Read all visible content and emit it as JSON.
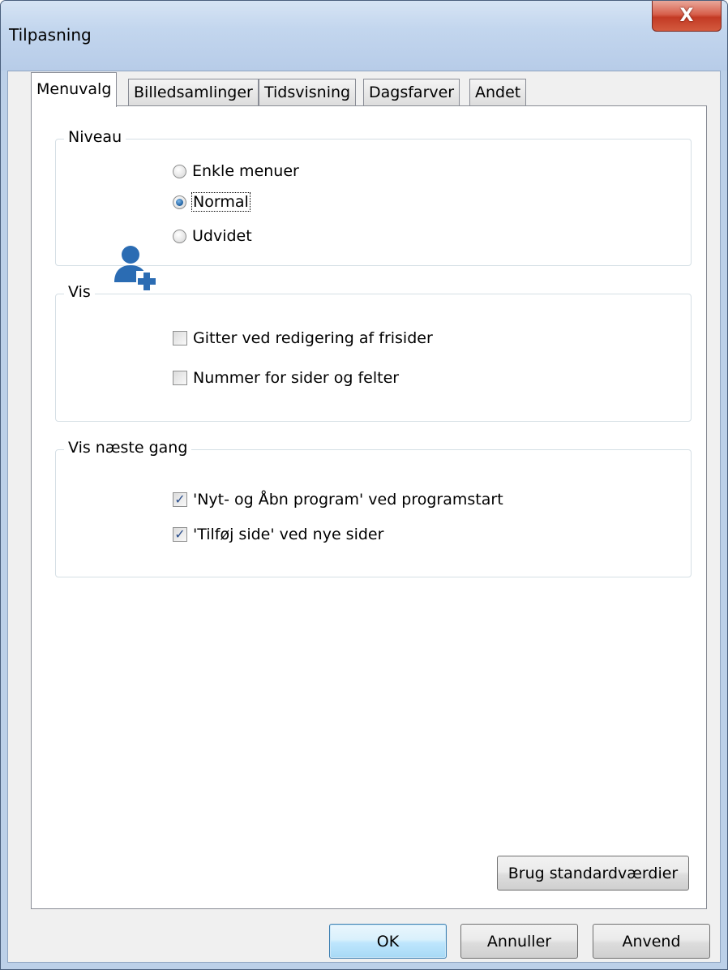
{
  "window": {
    "title": "Tilpasning",
    "close_label": "X"
  },
  "tabs": [
    {
      "label": "Menuvalg",
      "active": true
    },
    {
      "label": "Billedsamlinger",
      "active": false
    },
    {
      "label": "Tidsvisning",
      "active": false
    },
    {
      "label": "Dagsfarver",
      "active": false
    },
    {
      "label": "Andet",
      "active": false
    }
  ],
  "niveau": {
    "label": "Niveau",
    "icon": "user-add-icon",
    "options": [
      {
        "label": "Enkle menuer",
        "checked": false
      },
      {
        "label": "Normal",
        "checked": true
      },
      {
        "label": "Udvidet",
        "checked": false
      }
    ]
  },
  "vis": {
    "label": "Vis",
    "options": [
      {
        "label": "Gitter ved redigering af frisider",
        "checked": false
      },
      {
        "label": "Nummer for sider og felter",
        "checked": false
      }
    ]
  },
  "vis_naeste": {
    "label": "Vis næste gang",
    "options": [
      {
        "label": "'Nyt- og Åbn program' ved programstart",
        "checked": true
      },
      {
        "label": "'Tilføj side' ved nye sider",
        "checked": true
      }
    ]
  },
  "buttons": {
    "defaults": "Brug standardværdier",
    "ok": "OK",
    "cancel": "Annuller",
    "apply": "Anvend"
  },
  "colors": {
    "accent": "#2b6cb3",
    "frame": "#bcd0e8",
    "close": "#c33a24"
  }
}
